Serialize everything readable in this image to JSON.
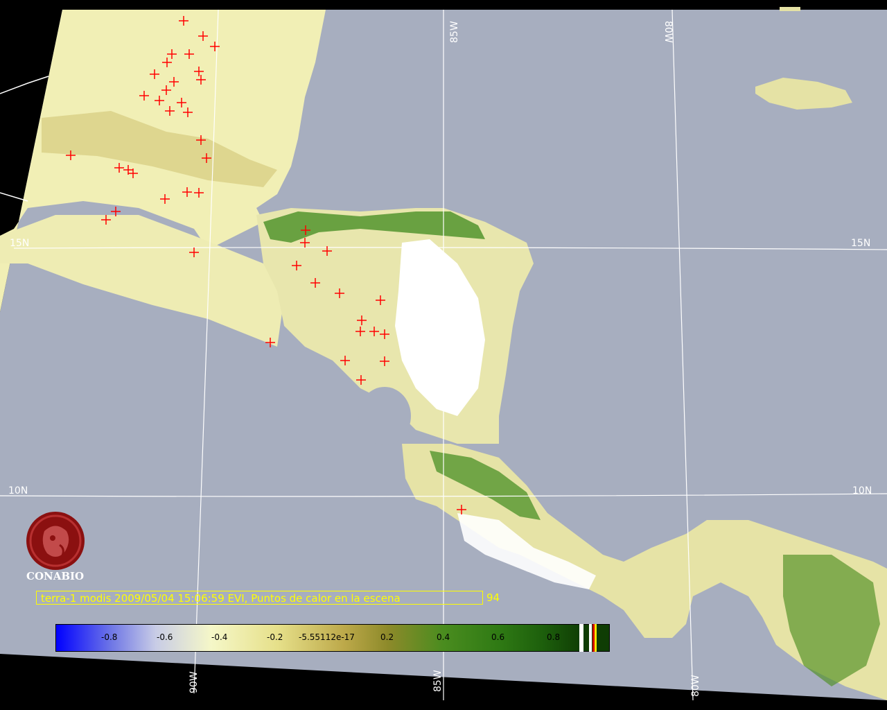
{
  "map": {
    "grid_labels": {
      "lat_15_left": "15N",
      "lat_15_right": "15N",
      "lat_10_left": "10N",
      "lat_10_right": "10N",
      "lon_85_top": "85W",
      "lon_80_top": "80W",
      "lon_90_bottom": "90W",
      "lon_85_bottom": "85W",
      "lon_80_bottom": "80W"
    },
    "colors": {
      "ocean": "#a7aebf",
      "background": "#000000",
      "vegetation_low": "#f3f2b8",
      "vegetation_mid": "#c9bd6a",
      "vegetation_high": "#2f7a14",
      "clouds": "#ffffff",
      "hotspot": "#ff0000",
      "grid": "#ffffff"
    }
  },
  "logo": {
    "name": "CONABIO"
  },
  "caption": {
    "text": "terra-1 modis 2009/05/04 15:06:59 EVI, Puntos de calor en la escena",
    "count": "94"
  },
  "colorbar": {
    "ticks": [
      "-0.8",
      "-0.6",
      "-0.4",
      "-0.2",
      "-5.55112e-17",
      "0.2",
      "0.4",
      "0.6",
      "0.8"
    ]
  }
}
